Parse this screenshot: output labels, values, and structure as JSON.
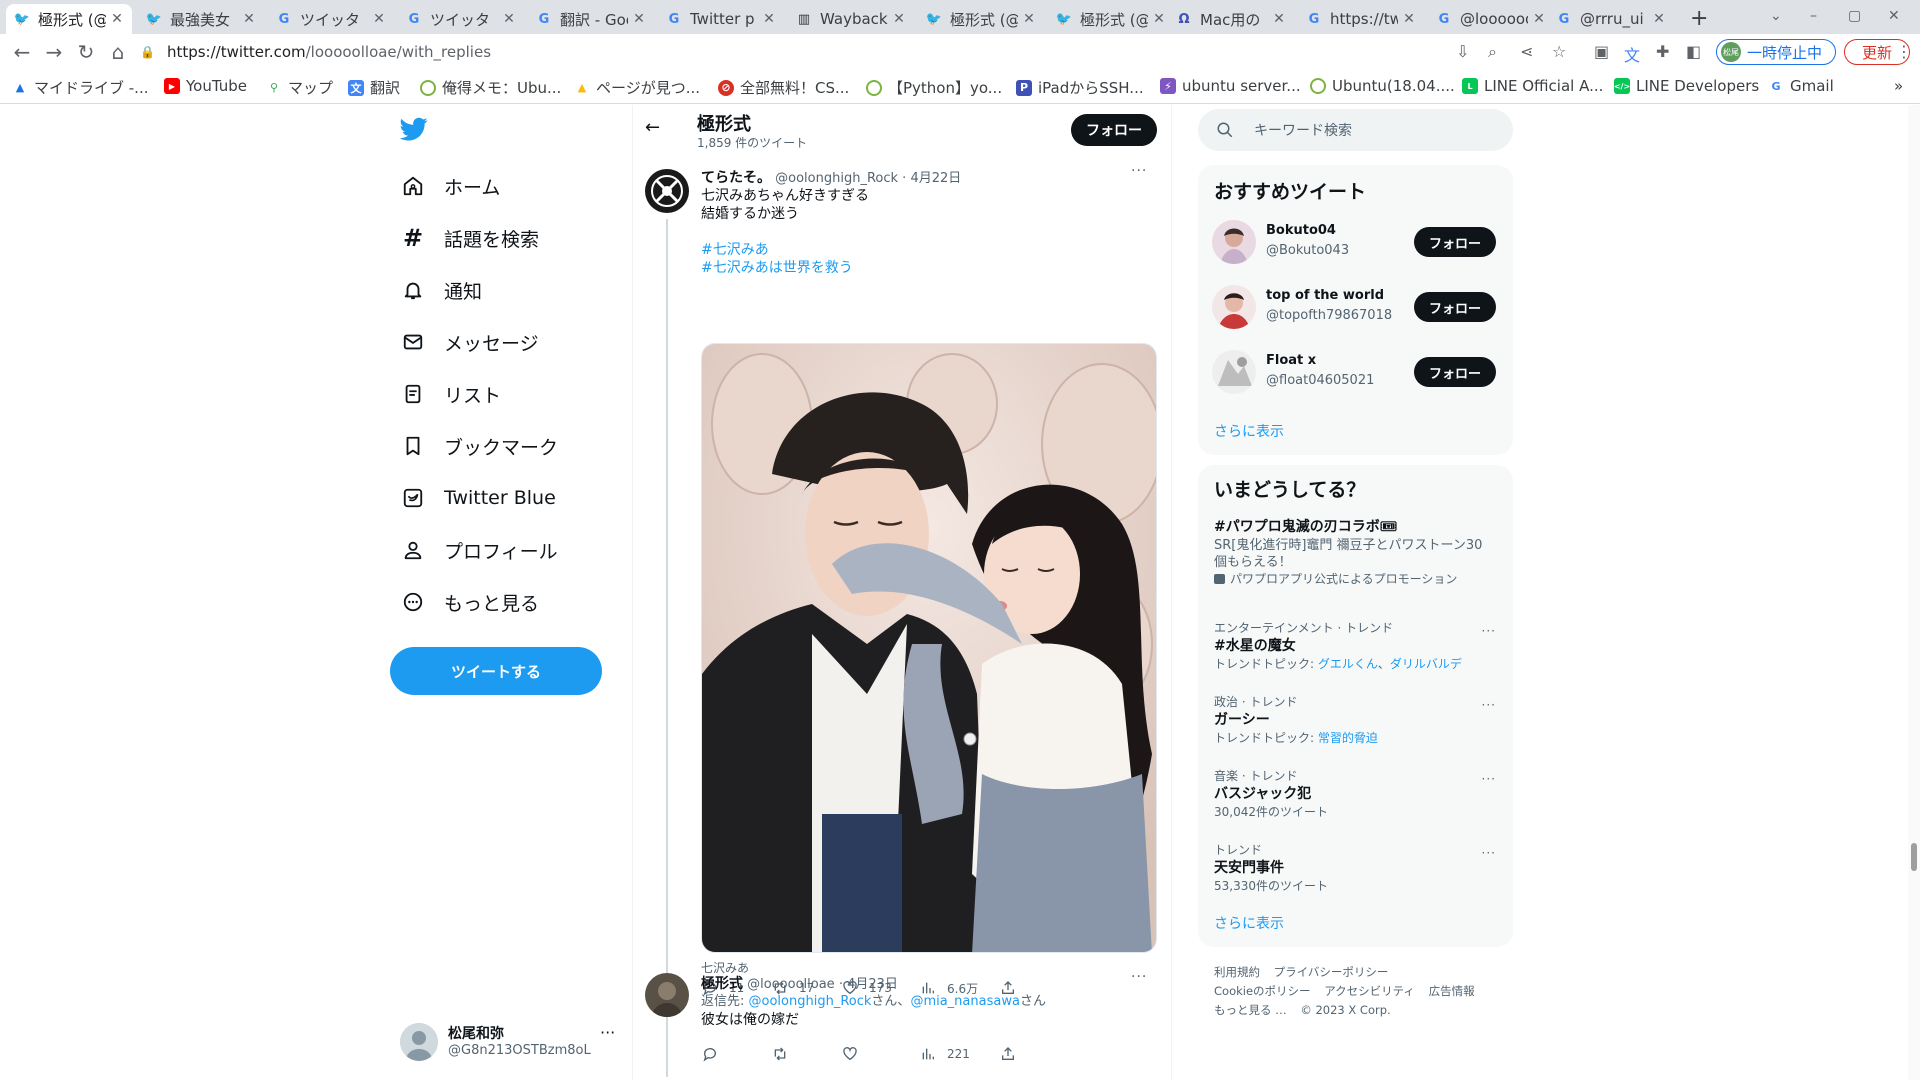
{
  "browser": {
    "tabs": [
      {
        "title": "極形式 (@",
        "icon": "twitter-bird-icon",
        "active": true
      },
      {
        "title": "最強美女",
        "icon": "twitter-bird-icon"
      },
      {
        "title": "ツイッタ",
        "icon": "google-g-icon"
      },
      {
        "title": "ツイッタ",
        "icon": "google-g-icon"
      },
      {
        "title": "翻訳 - Goo",
        "icon": "google-g-icon"
      },
      {
        "title": "Twitter p",
        "icon": "google-g-icon"
      },
      {
        "title": "Wayback",
        "icon": "wayback-icon"
      },
      {
        "title": "極形式 (@",
        "icon": "twitter-bird-icon"
      },
      {
        "title": "極形式 (@",
        "icon": "twitter-bird-icon"
      },
      {
        "title": "Mac用の",
        "icon": "mac-app-icon"
      },
      {
        "title": "https://tw",
        "icon": "google-g-icon"
      },
      {
        "title": "@loooooo",
        "icon": "google-g-icon"
      },
      {
        "title": "@rrru_ui",
        "icon": "google-g-icon"
      }
    ],
    "url_host": "https://twitter.com",
    "url_path": "/looooolloae/with_replies",
    "paused_label": "一時停止中",
    "paused_avatar": "松尾",
    "update_label": "更新",
    "bookmarks": [
      {
        "label": "マイドライブ -...",
        "icon": "google-drive-icon",
        "color": "#1a73e8"
      },
      {
        "label": "YouTube",
        "icon": "youtube-icon",
        "color": "#ff0000"
      },
      {
        "label": "マップ",
        "icon": "maps-pin-icon",
        "color": "#34a853"
      },
      {
        "label": "翻訳",
        "icon": "translate-icon",
        "color": "#4285f4"
      },
      {
        "label": "俺得メモ：Ubu...",
        "icon": "site-icon",
        "color": "#7cb342"
      },
      {
        "label": "ページが見つ...",
        "icon": "google-drive-icon",
        "color": "#fbbc04"
      },
      {
        "label": "全部無料！CS...",
        "icon": "site-icon",
        "color": "#d93025"
      },
      {
        "label": "【Python】yo...",
        "icon": "site-icon",
        "color": "#7cb342"
      },
      {
        "label": "iPadからSSH...",
        "icon": "p-icon",
        "color": "#3f51b5"
      },
      {
        "label": "ubuntu server...",
        "icon": "site-icon",
        "color": "#7e57c2"
      },
      {
        "label": "Ubuntu(18.04....",
        "icon": "site-icon",
        "color": "#7cb342"
      },
      {
        "label": "LINE Official A...",
        "icon": "line-icon",
        "color": "#06c755"
      },
      {
        "label": "LINE Developers",
        "icon": "line-icon",
        "color": "#06c755"
      },
      {
        "label": "Gmail",
        "icon": "google-g-icon",
        "color": "#4285f4"
      }
    ]
  },
  "sidebar": {
    "items": [
      {
        "label": "ホーム",
        "icon": "home-icon"
      },
      {
        "label": "話題を検索",
        "icon": "hashtag-icon"
      },
      {
        "label": "通知",
        "icon": "bell-icon"
      },
      {
        "label": "メッセージ",
        "icon": "envelope-icon"
      },
      {
        "label": "リスト",
        "icon": "list-icon"
      },
      {
        "label": "ブックマーク",
        "icon": "bookmark-icon"
      },
      {
        "label": "Twitter Blue",
        "icon": "twitter-blue-icon"
      },
      {
        "label": "プロフィール",
        "icon": "person-icon"
      },
      {
        "label": "もっと見る",
        "icon": "more-circle-icon"
      }
    ],
    "tweet_button": "ツイートする",
    "account": {
      "name": "松尾和弥",
      "handle": "@G8n213OSTBzm8oL",
      "more": "···"
    }
  },
  "profile_header": {
    "name": "極形式",
    "tweet_count": "1,859 件のツイート",
    "follow": "フォロー"
  },
  "tweets": [
    {
      "display_name": "てらたそ。",
      "handle": "@oolonghigh_Rock",
      "date": "4月22日",
      "text_lines": [
        "七沢みあちゃん好きすぎる",
        "結婚するか迷う"
      ],
      "hashtags": [
        "#七沢みあ",
        "#七沢みあは世界を救う"
      ],
      "media_caption": "七沢みあ",
      "replies": "11",
      "retweets": "17",
      "likes": "173",
      "views": "6.6万"
    },
    {
      "display_name": "極形式",
      "handle": "@looooolloae",
      "date": "4月23日",
      "reply_prefix": "返信先: ",
      "reply_to_1": "@oolonghigh_Rock",
      "reply_to_2": "@mia_nanasawa",
      "san": "さん",
      "text": "彼女は俺の嫁だ",
      "views": "221"
    }
  ],
  "right": {
    "search_placeholder": "キーワード検索",
    "recommended_title": "おすすめツイート",
    "who_to_follow": [
      {
        "name": "Bokuto04",
        "handle": "@Bokuto043",
        "button": "フォロー"
      },
      {
        "name": "top of the world",
        "handle": "@topofth79867018",
        "button": "フォロー"
      },
      {
        "name": "Float x",
        "handle": "@float04605021",
        "button": "フォロー"
      }
    ],
    "show_more": "さらに表示",
    "trends_title": "いまどうしてる？",
    "promoted": {
      "title": "#パワプロ鬼滅の刃コラボ🎟",
      "desc_1": "SR[鬼化進行時]竈門 禰豆子とパワストーン30",
      "desc_2": "個もらえる！",
      "promo": "パワプロアプリ公式によるプロモーション"
    },
    "trends": [
      {
        "context": "エンターテインメント · トレンド",
        "title": "#水星の魔女",
        "sub_prefix": "トレンドトピック: ",
        "sub_link_1": "グエルくん",
        "sub_sep": "、",
        "sub_link_2": "ダリルバルデ"
      },
      {
        "context": "政治 · トレンド",
        "title": "ガーシー",
        "sub_prefix": "トレンドトピック: ",
        "sub_link_1": "常習的脅迫"
      },
      {
        "context": "音楽 · トレンド",
        "title": "バスジャック犯",
        "count": "30,042件のツイート"
      },
      {
        "context": "トレンド",
        "title": "天安門事件",
        "count": "53,330件のツイート"
      }
    ],
    "trends_more": "さらに表示",
    "footer": {
      "terms": "利用規約",
      "privacy": "プライバシーポリシー",
      "cookie": "Cookieのポリシー",
      "accessibility": "アクセシビリティ",
      "ads": "広告情報",
      "more": "もっと見る …",
      "copyright": "© 2023 X Corp."
    }
  }
}
